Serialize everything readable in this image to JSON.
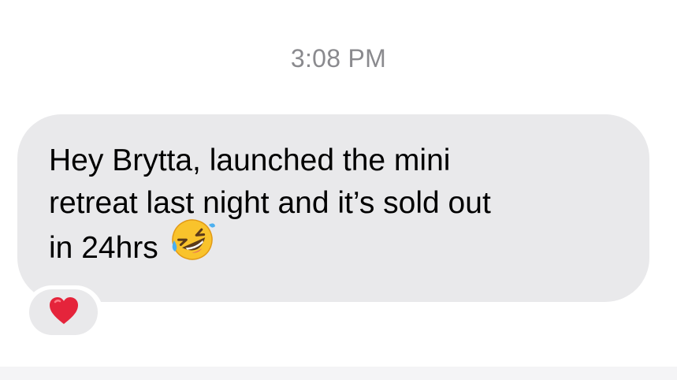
{
  "conversation": {
    "timestamp": "3:08 PM"
  },
  "message": {
    "lines": [
      "Hey Brytta, launched the mini",
      "retreat last night and it’s sold out",
      "in 24hrs"
    ],
    "emoji": "rolling-on-the-floor-laughing-icon",
    "bubble_color": "#e9e9eb"
  },
  "reaction": {
    "icon": "red-heart-icon",
    "color": "#e5243b"
  }
}
